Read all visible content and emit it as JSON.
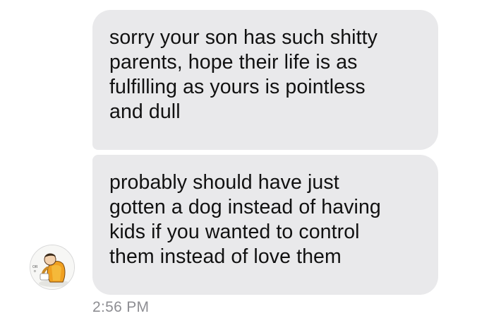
{
  "messages": [
    {
      "text": "sorry your son has such shitty\nparents, hope their life is as\nfulfilling as yours is pointless\nand dull"
    },
    {
      "text": "probably should have just\ngotten a dog instead of having\nkids if you wanted to control\nthem instead of love them"
    }
  ],
  "sender": {
    "avatar_icon": "cartoon-character-avatar"
  },
  "timestamp": "2:56 PM",
  "colors": {
    "bubble": "#e9e9eb",
    "text": "#111111",
    "timestamp": "#8e8e93",
    "background": "#ffffff"
  }
}
